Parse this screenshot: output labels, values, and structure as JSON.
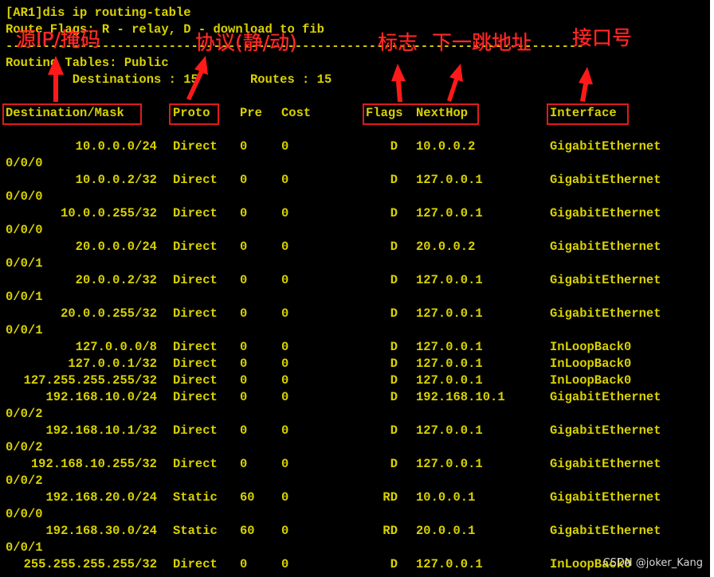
{
  "terminal": {
    "command": "[AR1]dis ip routing-table",
    "flags_legend": "Route Flags: R - relay, D - download to fib",
    "separator": "------------------------------------------------------------------------------",
    "table_title": "Routing Tables: Public",
    "summary": "         Destinations : 15       Routes : 15",
    "headers": {
      "dest": "Destination/Mask",
      "proto": "Proto",
      "pre": "Pre",
      "cost": "Cost",
      "flags": "Flags",
      "nexthop": "NextHop",
      "interface": "Interface"
    },
    "rows": [
      {
        "dest": "10.0.0.0/24",
        "proto": "Direct",
        "pre": "0",
        "cost": "0",
        "flags": "D",
        "next": "10.0.0.2",
        "iface": "GigabitEthernet",
        "cont": "0/0/0"
      },
      {
        "dest": "10.0.0.2/32",
        "proto": "Direct",
        "pre": "0",
        "cost": "0",
        "flags": "D",
        "next": "127.0.0.1",
        "iface": "GigabitEthernet",
        "cont": "0/0/0"
      },
      {
        "dest": "10.0.0.255/32",
        "proto": "Direct",
        "pre": "0",
        "cost": "0",
        "flags": "D",
        "next": "127.0.0.1",
        "iface": "GigabitEthernet",
        "cont": "0/0/0"
      },
      {
        "dest": "20.0.0.0/24",
        "proto": "Direct",
        "pre": "0",
        "cost": "0",
        "flags": "D",
        "next": "20.0.0.2",
        "iface": "GigabitEthernet",
        "cont": "0/0/1"
      },
      {
        "dest": "20.0.0.2/32",
        "proto": "Direct",
        "pre": "0",
        "cost": "0",
        "flags": "D",
        "next": "127.0.0.1",
        "iface": "GigabitEthernet",
        "cont": "0/0/1"
      },
      {
        "dest": "20.0.0.255/32",
        "proto": "Direct",
        "pre": "0",
        "cost": "0",
        "flags": "D",
        "next": "127.0.0.1",
        "iface": "GigabitEthernet",
        "cont": "0/0/1"
      },
      {
        "dest": "127.0.0.0/8",
        "proto": "Direct",
        "pre": "0",
        "cost": "0",
        "flags": "D",
        "next": "127.0.0.1",
        "iface": "InLoopBack0",
        "cont": ""
      },
      {
        "dest": "127.0.0.1/32",
        "proto": "Direct",
        "pre": "0",
        "cost": "0",
        "flags": "D",
        "next": "127.0.0.1",
        "iface": "InLoopBack0",
        "cont": ""
      },
      {
        "dest": "127.255.255.255/32",
        "proto": "Direct",
        "pre": "0",
        "cost": "0",
        "flags": "D",
        "next": "127.0.0.1",
        "iface": "InLoopBack0",
        "cont": ""
      },
      {
        "dest": "192.168.10.0/24",
        "proto": "Direct",
        "pre": "0",
        "cost": "0",
        "flags": "D",
        "next": "192.168.10.1",
        "iface": "GigabitEthernet",
        "cont": "0/0/2"
      },
      {
        "dest": "192.168.10.1/32",
        "proto": "Direct",
        "pre": "0",
        "cost": "0",
        "flags": "D",
        "next": "127.0.0.1",
        "iface": "GigabitEthernet",
        "cont": "0/0/2"
      },
      {
        "dest": "192.168.10.255/32",
        "proto": "Direct",
        "pre": "0",
        "cost": "0",
        "flags": "D",
        "next": "127.0.0.1",
        "iface": "GigabitEthernet",
        "cont": "0/0/2"
      },
      {
        "dest": "192.168.20.0/24",
        "proto": "Static",
        "pre": "60",
        "cost": "0",
        "flags": "RD",
        "next": "10.0.0.1",
        "iface": "GigabitEthernet",
        "cont": "0/0/0"
      },
      {
        "dest": "192.168.30.0/24",
        "proto": "Static",
        "pre": "60",
        "cost": "0",
        "flags": "RD",
        "next": "20.0.0.1",
        "iface": "GigabitEthernet",
        "cont": "0/0/1"
      },
      {
        "dest": "255.255.255.255/32",
        "proto": "Direct",
        "pre": "0",
        "cost": "0",
        "flags": "D",
        "next": "127.0.0.1",
        "iface": "InLoopBack0",
        "cont": ""
      }
    ]
  },
  "annotations": {
    "dest_label": "源IP/掩码",
    "proto_label": "协议(静/动)",
    "flags_label": "标志",
    "nexthop_label": "下一跳地址",
    "iface_label": "接口号"
  },
  "watermark": "CSDN @joker_Kang",
  "colors": {
    "terminal_bg": "#000000",
    "terminal_text": "#d9d200",
    "annotation_red": "#e11b1b"
  }
}
